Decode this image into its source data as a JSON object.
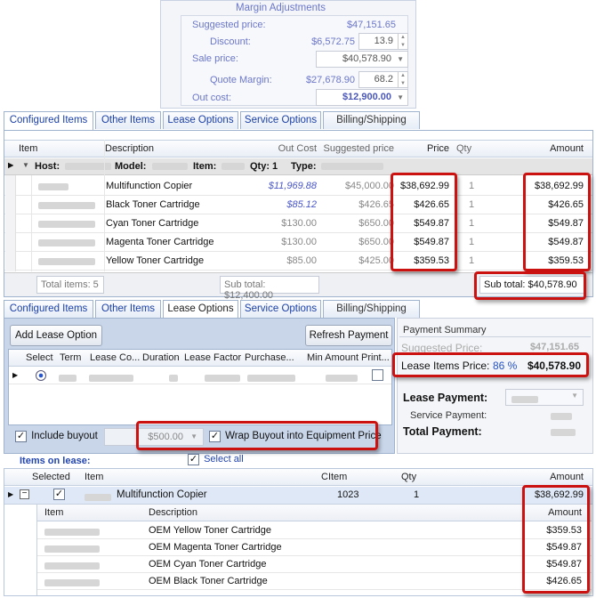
{
  "margin": {
    "title": "Margin Adjustments",
    "suggested_label": "Suggested price:",
    "suggested_value": "$47,151.65",
    "discount_label": "Discount:",
    "discount_value": "$6,572.75",
    "discount_pct": "13.9",
    "sale_label": "Sale price:",
    "sale_value": "$40,578.90",
    "quote_margin_label": "Quote Margin:",
    "quote_margin_value": "$27,678.90",
    "quote_margin_pct": "68.2",
    "outcost_label": "Out cost:",
    "outcost_value": "$12,900.00"
  },
  "tabs1": [
    "Configured Items",
    "Other Items",
    "Lease Options",
    "Service Options",
    "Billing/Shipping"
  ],
  "grid1": {
    "headers": [
      "Item",
      "Description",
      "Out Cost",
      "Suggested price",
      "Price",
      "Qty",
      "Amount"
    ],
    "group": {
      "host": "Host:",
      "model": "Model:",
      "item": "Item:",
      "qty": "Qty: 1",
      "type": "Type:"
    },
    "rows": [
      {
        "desc": "Multifunction Copier",
        "outcost": "$11,969.88",
        "suggested": "$45,000.00",
        "price": "$38,692.99",
        "qty": "1",
        "amount": "$38,692.99"
      },
      {
        "desc": "Black Toner Cartridge",
        "outcost": "$85.12",
        "suggested": "$426.65",
        "price": "$426.65",
        "qty": "1",
        "amount": "$426.65"
      },
      {
        "desc": "Cyan Toner Cartridge",
        "outcost": "$130.00",
        "suggested": "$650.00",
        "price": "$549.87",
        "qty": "1",
        "amount": "$549.87"
      },
      {
        "desc": "Magenta Toner Cartridge",
        "outcost": "$130.00",
        "suggested": "$650.00",
        "price": "$549.87",
        "qty": "1",
        "amount": "$549.87"
      },
      {
        "desc": "Yellow Toner Cartridge",
        "outcost": "$85.00",
        "suggested": "$425.00",
        "price": "$359.53",
        "qty": "1",
        "amount": "$359.53"
      }
    ],
    "total_items": "Total items: 5",
    "subtotal_cost": "Sub total: $12,400.00",
    "subtotal_amount": "Sub total: $40,578.90"
  },
  "tabs2": [
    "Configured Items",
    "Other Items",
    "Lease Options",
    "Service Options",
    "Billing/Shipping"
  ],
  "lease": {
    "add_button": "Add Lease Option",
    "refresh_button": "Refresh Payment",
    "headers": [
      "Select",
      "Term",
      "Lease Co...",
      "Duration",
      "Lease Factor",
      "Purchase...",
      "Min Amount",
      "Print..."
    ],
    "include_buyout": "Include buyout",
    "buyout_value": "$500.00",
    "wrap_buyout": "Wrap Buyout into Equipment Price"
  },
  "payment": {
    "title": "Payment Summary",
    "suggested_label": "Suggested Price:",
    "suggested_value": "$47,151.65",
    "lease_items_label": "Lease Items Price:",
    "lease_items_pct": "86 %",
    "lease_items_value": "$40,578.90",
    "lease_payment_label": "Lease Payment:",
    "service_payment_label": "Service Payment:",
    "total_payment_label": "Total Payment:"
  },
  "items_on_lease": {
    "title": "Items on lease:",
    "select_all": "Select all",
    "headers": [
      "Selected",
      "Item",
      "CItem",
      "Qty",
      "Amount"
    ],
    "main": {
      "desc": "Multifunction Copier",
      "citem": "1023",
      "qty": "1",
      "amount": "$38,692.99"
    },
    "sub_headers": [
      "Item",
      "Description",
      "Amount"
    ],
    "sub_rows": [
      {
        "desc": "OEM Yellow Toner Cartridge",
        "amount": "$359.53"
      },
      {
        "desc": "OEM Magenta Toner Cartridge",
        "amount": "$549.87"
      },
      {
        "desc": "OEM Cyan Toner Cartridge",
        "amount": "$549.87"
      },
      {
        "desc": "OEM Black Toner Cartridge",
        "amount": "$426.65"
      }
    ]
  }
}
